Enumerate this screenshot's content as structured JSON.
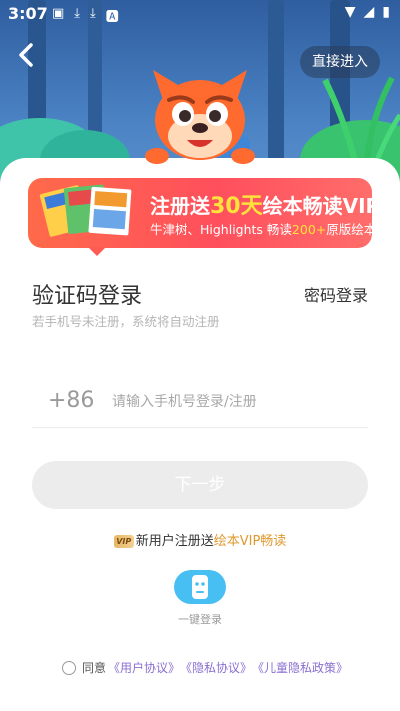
{
  "status_bar": {
    "time": "3:07"
  },
  "header": {
    "skip_label": "直接进入"
  },
  "promo": {
    "title_prefix": "注册送",
    "title_highlight": "30天",
    "title_suffix": "绘本畅读VIP",
    "subtitle_prefix": "牛津树、Highlights 畅读",
    "subtitle_highlight": "200+",
    "subtitle_suffix": "原版绘本"
  },
  "login": {
    "title": "验证码登录",
    "alt_login": "密码登录",
    "hint": "若手机号未注册，系统将自动注册",
    "country_code": "+86",
    "phone_placeholder": "请输入手机号登录/注册",
    "phone_value": "",
    "next_label": "下一步"
  },
  "vip_note": {
    "badge": "VIP",
    "text": "新用户注册送",
    "accent": "绘本VIP畅读"
  },
  "one_key": {
    "label": "一键登录"
  },
  "agreement": {
    "prefix": "同意",
    "user_agreement": "《用户协议》",
    "privacy": "《隐私协议》",
    "child_privacy": "《儿童隐私政策》"
  },
  "colors": {
    "brand_blue": "#48bff2",
    "promo_red": "#ff5b55",
    "promo_yellow": "#ffe23c",
    "link_purple": "#8a6fd1",
    "vip_gold": "#e0982f"
  }
}
